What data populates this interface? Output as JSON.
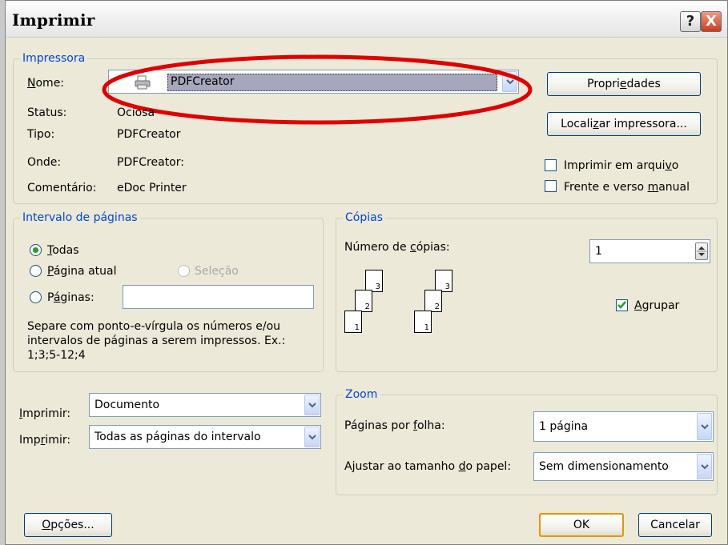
{
  "window": {
    "title": "Imprimir",
    "help_glyph": "?",
    "close_glyph": "X"
  },
  "printer": {
    "legend": "Impressora",
    "name_label": "Nome:",
    "name_value": "PDFCreator",
    "status_label": "Status:",
    "status_value": "Ociosa",
    "type_label": "Tipo:",
    "type_value": "PDFCreator",
    "where_label": "Onde:",
    "where_value": "PDFCreator:",
    "comment_label": "Comentário:",
    "comment_value": "eDoc Printer",
    "properties_button": "Propriedades",
    "find_printer_button": "Localizar impressora...",
    "print_to_file": {
      "label": "Imprimir em arquivo",
      "checked": false
    },
    "manual_duplex": {
      "label": "Frente e verso manual",
      "checked": false
    }
  },
  "page_range": {
    "legend": "Intervalo de páginas",
    "all_label": "Todas",
    "current_label": "Página atual",
    "selection_label": "Seleção",
    "pages_label": "Páginas:",
    "pages_value": "",
    "selected": "all",
    "hint_line1": "Separe com ponto-e-vírgula os números e/ou",
    "hint_line2": "intervalos de páginas a serem impressos.  Ex.:",
    "hint_line3": "1;3;5-12;4"
  },
  "copies": {
    "legend": "Cópias",
    "number_label": "Número de cópias:",
    "number_value": "1",
    "collate": {
      "label": "Agrupar",
      "checked": true
    },
    "page_numbers": [
      "1",
      "2",
      "3"
    ]
  },
  "print_what": {
    "label": "Imprimir:",
    "value": "Documento"
  },
  "print_pages": {
    "label": "Imprimir:",
    "value": "Todas as páginas do intervalo"
  },
  "zoom": {
    "legend": "Zoom",
    "pages_per_sheet_label": "Páginas por folha:",
    "pages_per_sheet_value": "1 página",
    "scale_label": "Ajustar ao tamanho do papel:",
    "scale_value": "Sem dimensionamento"
  },
  "footer": {
    "options_button": "Opções...",
    "ok_button": "OK",
    "cancel_button": "Cancelar"
  },
  "colors": {
    "annotation_ellipse": "#e00000",
    "group_legend": "#0046d5",
    "dialog_bg": "#ece9d8"
  }
}
